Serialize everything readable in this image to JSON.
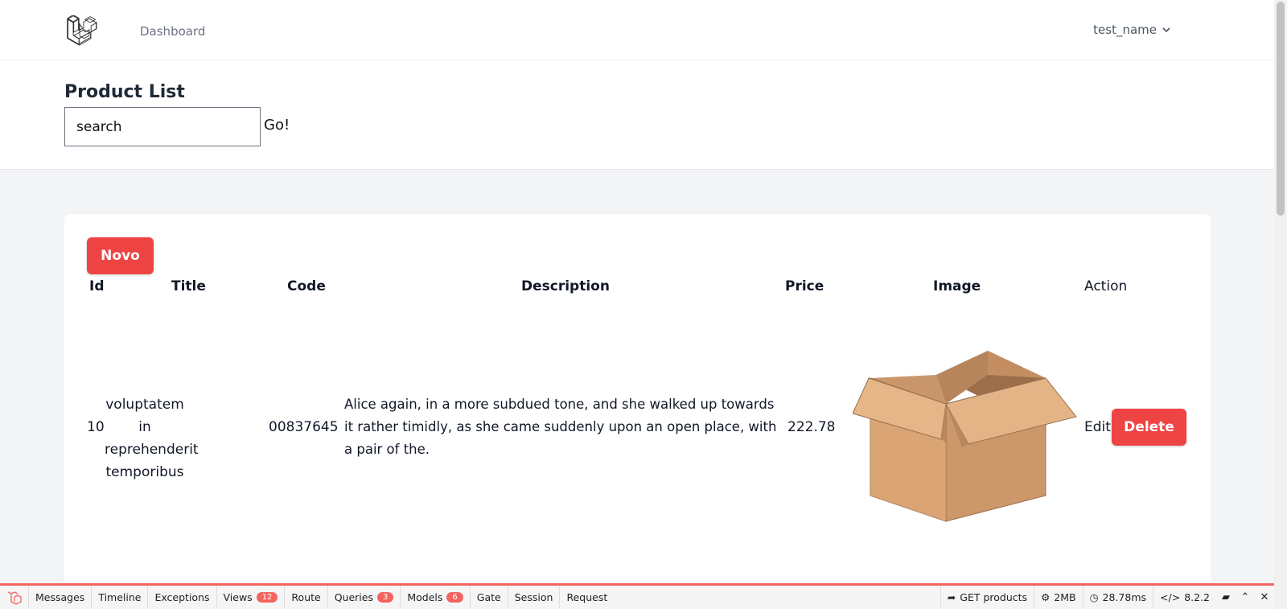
{
  "nav": {
    "dashboard_label": "Dashboard",
    "user_name": "test_name"
  },
  "header": {
    "title": "Product List",
    "search_placeholder": "search",
    "go_label": "Go!"
  },
  "card": {
    "new_label": "Novo"
  },
  "table": {
    "headers": [
      "Id",
      "Title",
      "Code",
      "Description",
      "Price",
      "Image",
      "Action"
    ],
    "rows": [
      {
        "id": "10",
        "title": [
          "voluptatem in",
          "reprehenderit",
          "temporibus"
        ],
        "code": "00837645",
        "description": [
          "Alice again, in a more subdued tone, and she walked up towards",
          "it rather timidly, as she came suddenly upon an open place, with",
          "a pair of the."
        ],
        "price": "222.78",
        "image": "cardboard-box-icon",
        "edit_label": "Edit",
        "delete_label": "Delete"
      }
    ]
  },
  "debugbar": {
    "tabs": [
      {
        "label": "Messages"
      },
      {
        "label": "Timeline"
      },
      {
        "label": "Exceptions"
      },
      {
        "label": "Views",
        "badge": "12"
      },
      {
        "label": "Route"
      },
      {
        "label": "Queries",
        "badge": "3"
      },
      {
        "label": "Models",
        "badge": "6"
      },
      {
        "label": "Gate"
      },
      {
        "label": "Session"
      },
      {
        "label": "Request"
      }
    ],
    "request": "GET products",
    "memory": "2MB",
    "time": "28.78ms",
    "php_version": "8.2.2"
  },
  "colors": {
    "accent": "#ef4444",
    "debugbar_accent": "#f4645f"
  }
}
